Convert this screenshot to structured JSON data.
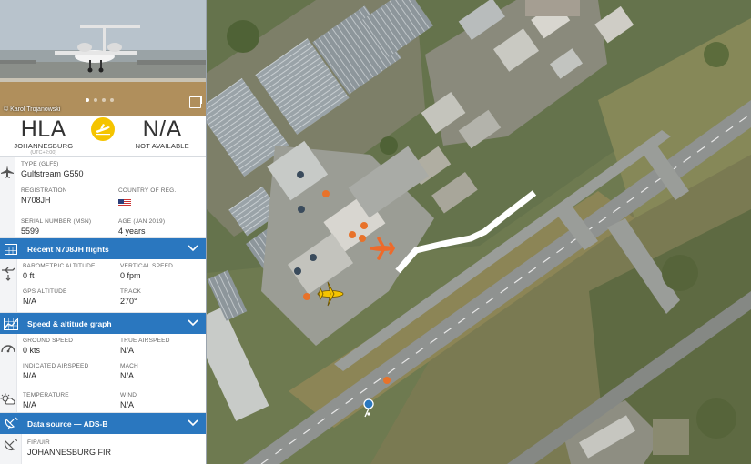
{
  "photo": {
    "credit": "© Karol Trojanowski",
    "dots": 4,
    "active_dot": 0
  },
  "route": {
    "origin_code": "HLA",
    "origin_city": "JOHANNESBURG",
    "origin_tz": "(UTC+2:00)",
    "dest_code": "N/A",
    "dest_city": "NOT AVAILABLE"
  },
  "aircraft": {
    "type_label": "TYPE (GLF5)",
    "type_value": "Gulfstream G550",
    "registration_label": "REGISTRATION",
    "registration_value": "N708JH",
    "country_label": "COUNTRY OF REG.",
    "serial_label": "SERIAL NUMBER (MSN)",
    "serial_value": "5599",
    "age_label": "AGE (JAN 2019)",
    "age_value": "4 years"
  },
  "recent_bar": {
    "label": "Recent N708JH flights"
  },
  "altitude": {
    "baro_label": "BAROMETRIC ALTITUDE",
    "baro_value": "0 ft",
    "vspeed_label": "VERTICAL SPEED",
    "vspeed_value": "0 fpm",
    "gps_label": "GPS ALTITUDE",
    "gps_value": "N/A",
    "track_label": "TRACK",
    "track_value": "270°"
  },
  "graph_bar": {
    "label": "Speed & altitude graph"
  },
  "speed": {
    "ground_label": "GROUND SPEED",
    "ground_value": "0 kts",
    "true_label": "TRUE AIRSPEED",
    "true_value": "N/A",
    "indicated_label": "INDICATED AIRSPEED",
    "indicated_value": "N/A",
    "mach_label": "MACH",
    "mach_value": "N/A"
  },
  "weather": {
    "temp_label": "TEMPERATURE",
    "temp_value": "N/A",
    "wind_label": "WIND",
    "wind_value": "N/A"
  },
  "source_bar": {
    "label": "Data source — ADS-B"
  },
  "fir": {
    "fir_label": "FIR/UIR",
    "fir_value": "JOHANNESBURG FIR"
  },
  "colors": {
    "accent": "#2a77bf",
    "selected_plane": "#f5c400",
    "other_plane": "#ee6a2a",
    "track": "#ffffff"
  }
}
